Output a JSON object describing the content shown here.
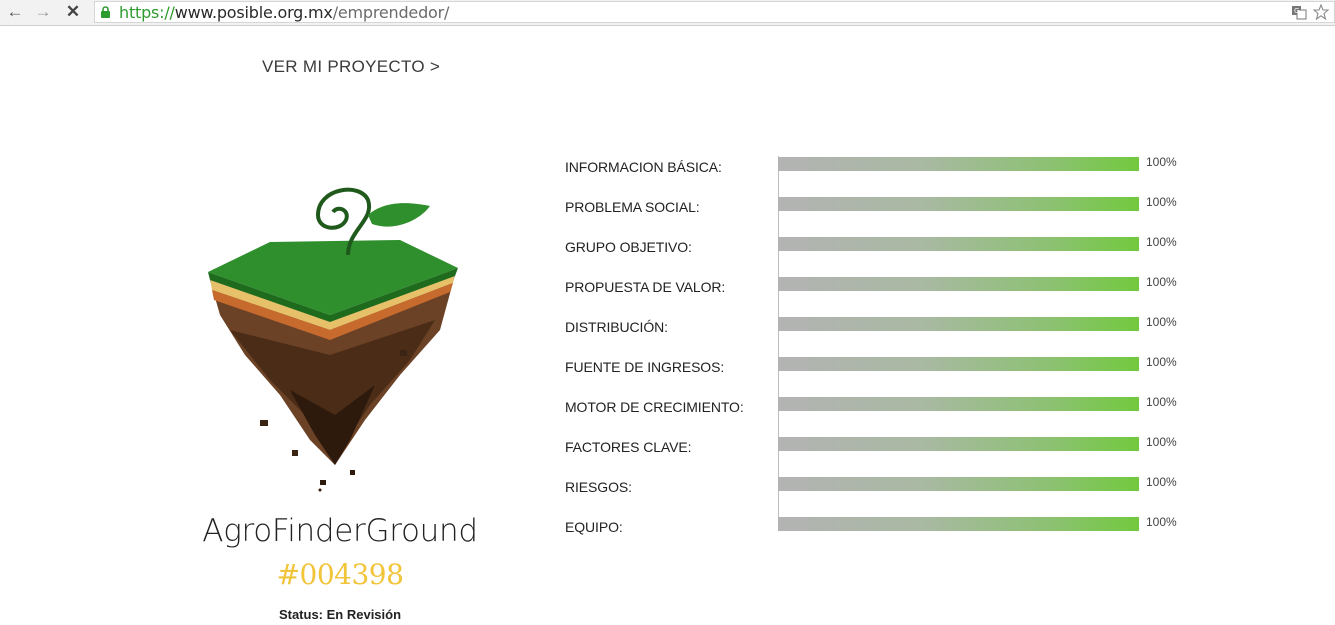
{
  "browser": {
    "url_scheme": "https://",
    "url_host": "www.posible.org.mx",
    "url_path": "/emprendedor/"
  },
  "project": {
    "link_label": "VER MI PROYECTO >",
    "name": "AgroFinderGround",
    "id": "#004398",
    "status": "Status: En Revisión"
  },
  "progress": [
    {
      "label": "INFORMACION BÁSICA:",
      "value": "100%"
    },
    {
      "label": "PROBLEMA SOCIAL:",
      "value": "100%"
    },
    {
      "label": "GRUPO OBJETIVO:",
      "value": "100%"
    },
    {
      "label": "PROPUESTA DE VALOR:",
      "value": "100%"
    },
    {
      "label": "DISTRIBUCIÓN:",
      "value": "100%"
    },
    {
      "label": "FUENTE DE INGRESOS:",
      "value": "100%"
    },
    {
      "label": "MOTOR DE CRECIMIENTO:",
      "value": "100%"
    },
    {
      "label": "FACTORES CLAVE:",
      "value": "100%"
    },
    {
      "label": "RIESGOS:",
      "value": "100%"
    },
    {
      "label": "EQUIPO:",
      "value": "100%"
    }
  ],
  "colors": {
    "accent_id": "#f2c43a",
    "bar_end": "#72c93e",
    "bar_start": "#b3b3b3"
  }
}
